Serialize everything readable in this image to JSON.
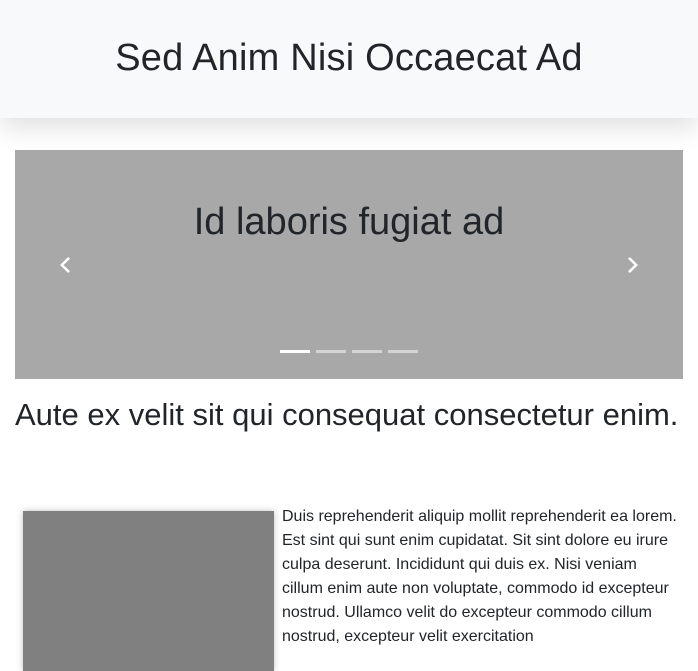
{
  "header": {
    "title": "Sed Anim Nisi Occaecat Ad"
  },
  "carousel": {
    "caption": "Id laboris fugiat ad",
    "prev_icon": "chevron-left-icon",
    "next_icon": "chevron-right-icon",
    "indicator_count": 4,
    "active_index": 0,
    "background": "#a8a8a8"
  },
  "main": {
    "heading": "Aute ex velit sit qui consequat consectetur enim.",
    "image_color": "#808080",
    "paragraph": "Duis reprehenderit aliquip mollit reprehenderit ea lorem. Est sint qui sunt enim cupidatat. Sit sint dolore eu irure culpa deserunt. Incididunt qui duis ex. Nisi veniam cillum enim aute non voluptate, commodo id excepteur nostrud. Ullamco velit do excepteur commodo cillum nostrud, excepteur velit exercitation"
  }
}
